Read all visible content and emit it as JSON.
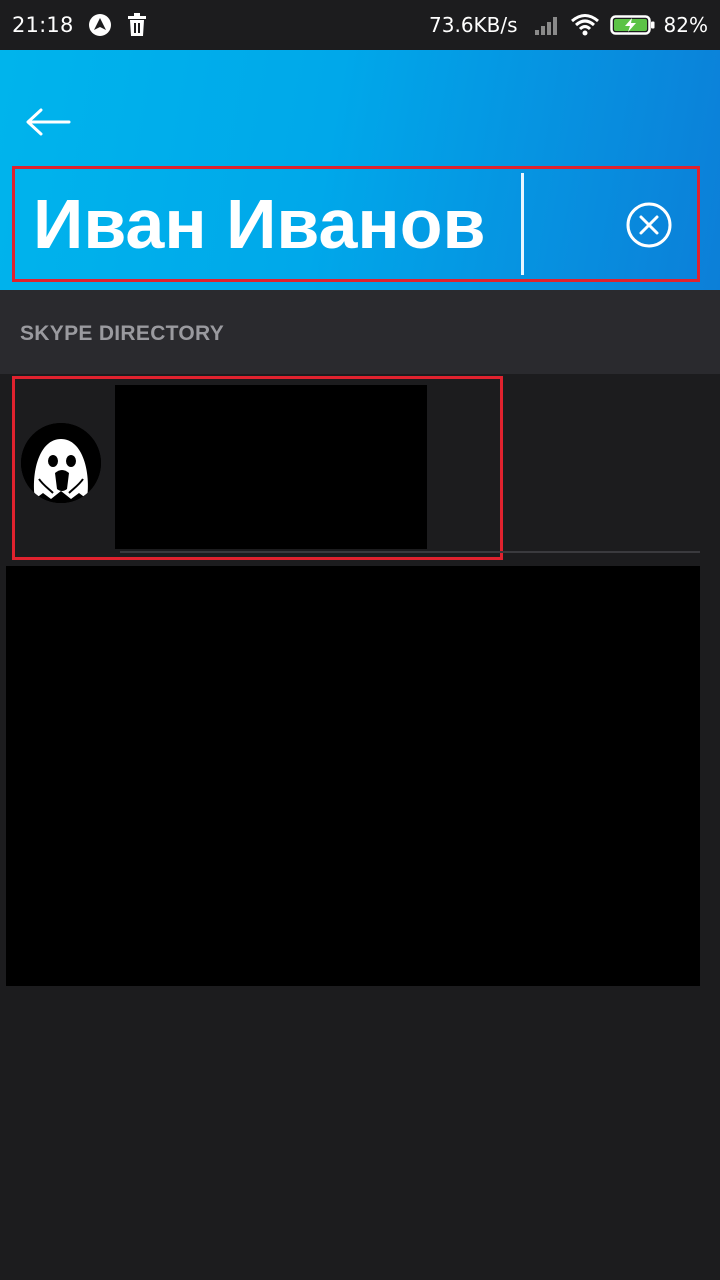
{
  "status_bar": {
    "time": "21:18",
    "network_speed": "73.6KB/s",
    "battery_percent": "82%",
    "icons": [
      "autopilot-icon",
      "trash-icon",
      "cell-signal-icon",
      "wifi-icon",
      "battery-charging-icon"
    ]
  },
  "header": {
    "back_icon": "arrow-left-icon",
    "search_value": "Иван Иванов",
    "clear_icon": "close-circle-icon",
    "gradient_colors": [
      "#00b4ec",
      "#0c7fd8"
    ]
  },
  "directory": {
    "section_title": "SKYPE DIRECTORY",
    "results": [
      {
        "avatar_icon": "ghost-avatar-icon",
        "name_redacted": true
      }
    ]
  },
  "colors": {
    "background": "#1c1c1e",
    "section_background": "#2a2a2e",
    "highlight_outline": "#e0222e",
    "section_text": "#9a9a9f"
  }
}
